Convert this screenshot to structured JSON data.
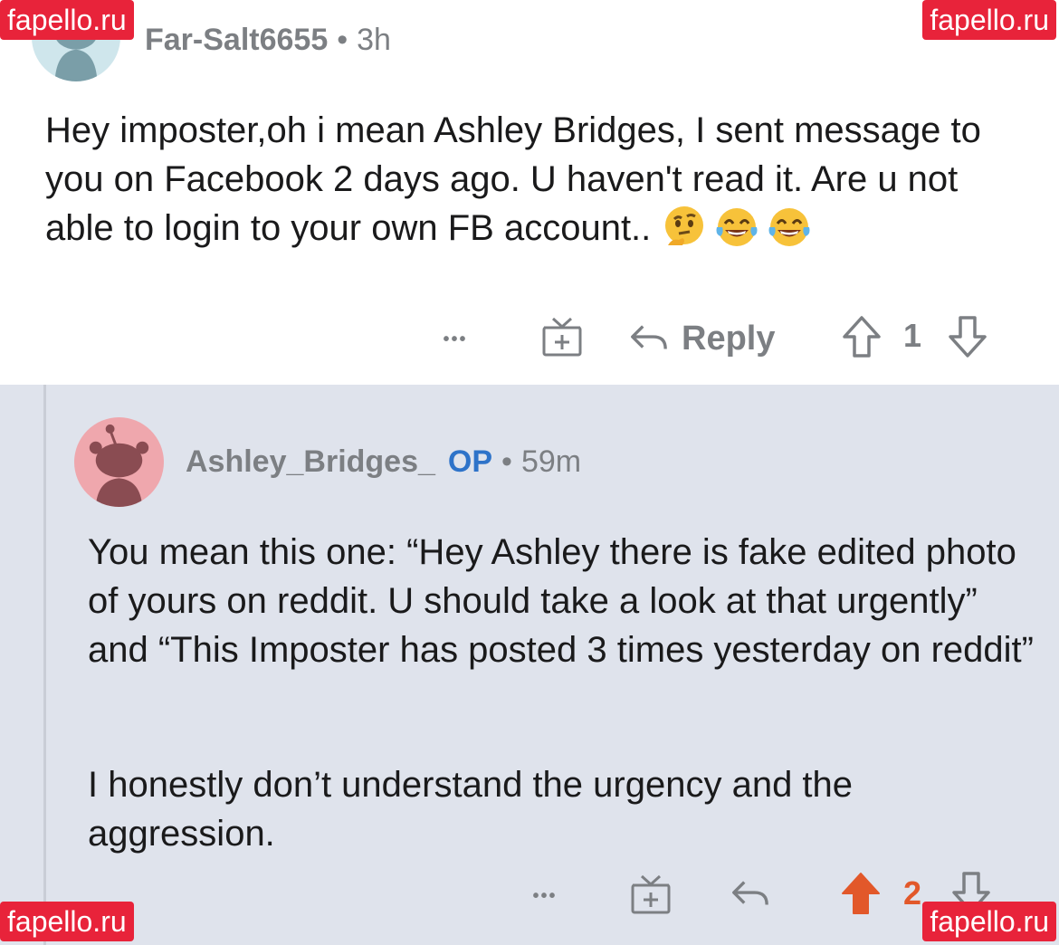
{
  "parent_comment": {
    "username": "Far-Salt6655",
    "separator": "•",
    "age": "3h",
    "text": "Hey imposter,oh i mean Ashley Bridges, I sent message to you on Facebook 2 days ago. U haven't read it. Are u not able to login to your own FB account..",
    "emojis": [
      "thinking-face",
      "tears-of-joy",
      "tears-of-joy"
    ],
    "actions": {
      "more": "•••",
      "reply_label": "Reply",
      "score": "1"
    }
  },
  "reply_comment": {
    "username": "Ashley_Bridges_",
    "op_badge": "OP",
    "separator": "•",
    "age": "59m",
    "paragraph_1": "You mean this one: “Hey Ashley there is fake edited photo of yours on reddit. U should take a look at that urgently” and “This Imposter has posted 3 times yesterday on reddit”",
    "paragraph_2": "I honestly don’t understand the urgency and the aggression.",
    "actions": {
      "more": "•••",
      "score": "2",
      "upvoted": true
    }
  },
  "watermarks": {
    "top_left": "fapello.ru",
    "top_right": "fapello.ru",
    "bottom_left": "fapello.ru",
    "bottom_right": "fapello.ru"
  },
  "colors": {
    "op_blue": "#2e73c9",
    "upvote_orange": "#e2582a",
    "reply_bg": "#dfe3ec",
    "watermark_red": "#e8233a"
  }
}
